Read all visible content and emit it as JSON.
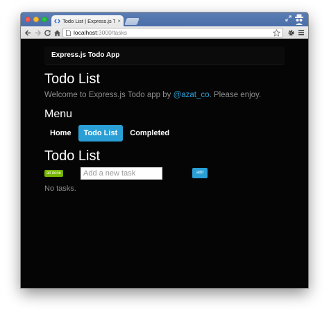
{
  "browser": {
    "tab_title": "Todo List | Express.js Todo App",
    "tab_close": "×",
    "url_host": "localhost",
    "url_path": ":3000/tasks"
  },
  "app": {
    "brand": "Express.js Todo App",
    "page_title": "Todo List",
    "welcome_prefix": "Welcome to Express.js Todo app by ",
    "welcome_link": "@azat_co",
    "welcome_suffix": ". Please enjoy.",
    "menu_heading": "Menu",
    "menu": [
      {
        "label": "Home"
      },
      {
        "label": "Todo List",
        "active": true
      },
      {
        "label": "Completed"
      }
    ],
    "list_heading": "Todo List",
    "all_done_label": "all done",
    "new_task_placeholder": "Add a new task",
    "add_label": "add",
    "empty_message": "No tasks."
  },
  "colors": {
    "background": "#050505",
    "accent": "#2a9fd6",
    "success": "#77b300",
    "muted_text": "#8d8d8d"
  }
}
